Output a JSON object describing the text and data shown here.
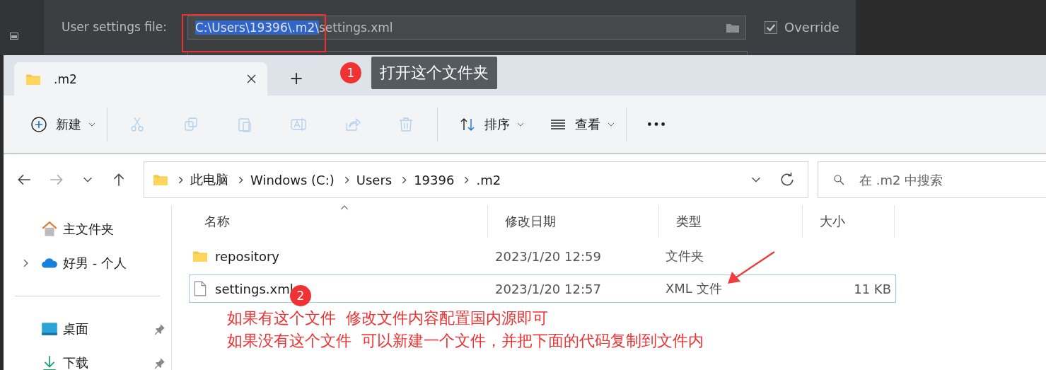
{
  "ide_settings": {
    "label": "User settings file:",
    "path_selected": "C:\\Users\\19396\\.m2\\",
    "path_rest": "settings.xml",
    "override": {
      "label": "Override",
      "checked": true
    }
  },
  "explorer": {
    "tabs": [
      {
        "label": ".m2",
        "selected": true
      }
    ],
    "new_tab": "+",
    "toolbar": [
      {
        "kind": "new",
        "label": "新建",
        "disabled": false
      },
      {
        "kind": "cut",
        "disabled": true
      },
      {
        "kind": "copy",
        "disabled": true
      },
      {
        "kind": "paste",
        "disabled": true
      },
      {
        "kind": "rename",
        "disabled": true
      },
      {
        "kind": "share",
        "disabled": true
      },
      {
        "kind": "delete",
        "disabled": true
      },
      {
        "kind": "sort",
        "label": "排序",
        "disabled": false
      },
      {
        "kind": "view",
        "label": "查看",
        "disabled": false
      },
      {
        "kind": "more",
        "disabled": false
      }
    ],
    "breadcrumb": [
      "此电脑",
      "Windows (C:)",
      "Users",
      "19396",
      ".m2"
    ],
    "search": {
      "placeholder": "在 .m2 中搜索"
    },
    "sidebar": {
      "groups": [
        [
          {
            "kind": "home",
            "label": "主文件夹",
            "pinned": false
          },
          {
            "kind": "cloud",
            "label": "好男 - 个人",
            "expanded": false,
            "pinned": false
          }
        ],
        [
          {
            "kind": "desktop",
            "label": "桌面",
            "pinned": true
          },
          {
            "kind": "download",
            "label": "下载",
            "pinned": true
          }
        ]
      ]
    },
    "columns": [
      "名称",
      "修改日期",
      "类型",
      "大小"
    ],
    "rows": [
      {
        "kind": "folder",
        "name": "repository",
        "date": "2023/1/20 12:59",
        "type": "文件夹",
        "size": "",
        "selected": false
      },
      {
        "kind": "file",
        "name": "settings.xml",
        "date": "2023/1/20 12:57",
        "type": "XML 文件",
        "size": "11 KB",
        "selected": true
      }
    ]
  },
  "annotations": {
    "step1": {
      "number": "1",
      "text": "打开这个文件夹"
    },
    "step2": {
      "number": "2"
    },
    "note_lines": [
      "如果有这个文件  修改文件内容配置国内源即可",
      "如果没有这个文件  可以新建一个文件，并把下面的代码复制到文件内"
    ]
  }
}
